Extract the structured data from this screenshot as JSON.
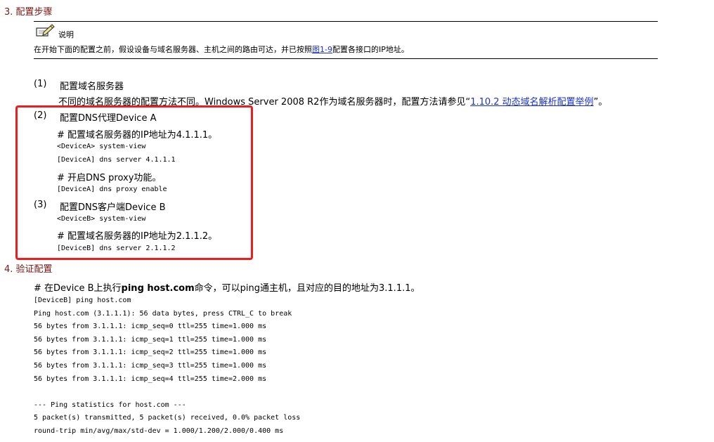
{
  "colors": {
    "heading": "#7a1712",
    "link": "#1a33cc",
    "highlight_box": "#ee1c1c"
  },
  "section3": {
    "heading": "3. 配置步骤",
    "note": {
      "label": "说明",
      "text_before": "在开始下面的配置之前，假设设备与域名服务器、主机之间的路由可达，并已按照",
      "link": "图1-9",
      "text_after": "配置各接口的IP地址。"
    },
    "step1": {
      "num": "(1)",
      "title": "配置域名服务器",
      "desc_before": "不同的域名服务器的配置方法不同。Windows Server 2008 R2作为域名服务器时，配置方法请参见“",
      "desc_link": "1.10.2  动态域名解析配置举例",
      "desc_after": "”。"
    },
    "step2": {
      "num": "(2)",
      "title": "配置DNS代理Device A",
      "comment1": "# 配置域名服务器的IP地址为4.1.1.1。",
      "cmd1": "<DeviceA> system-view",
      "cmd2": "[DeviceA] dns server 4.1.1.1",
      "comment2": "# 开启DNS proxy功能。",
      "cmd3": "[DeviceA] dns proxy enable"
    },
    "step3": {
      "num": "(3)",
      "title": "配置DNS客户端Device B",
      "cmd1": "<DeviceB> system-view",
      "comment1": "# 配置域名服务器的IP地址为2.1.1.2。",
      "cmd2": "[DeviceB] dns server 2.1.1.2"
    }
  },
  "section4": {
    "heading": "4. 验证配置",
    "intro_before": "# 在Device B上执行",
    "intro_bold": "ping host.com",
    "intro_after": "命令，可以ping通主机，且对应的目的地址为3.1.1.1。",
    "output": [
      "[DeviceB] ping host.com",
      "Ping host.com (3.1.1.1): 56 data bytes, press CTRL_C to break",
      "56 bytes from 3.1.1.1: icmp_seq=0 ttl=255 time=1.000 ms",
      "56 bytes from 3.1.1.1: icmp_seq=1 ttl=255 time=1.000 ms",
      "56 bytes from 3.1.1.1: icmp_seq=2 ttl=255 time=1.000 ms",
      "56 bytes from 3.1.1.1: icmp_seq=3 ttl=255 time=1.000 ms",
      "56 bytes from 3.1.1.1: icmp_seq=4 ttl=255 time=2.000 ms",
      "",
      "--- Ping statistics for host.com ---",
      "5 packet(s) transmitted, 5 packet(s) received, 0.0% packet loss",
      "round-trip min/avg/max/std-dev = 1.000/1.200/2.000/0.400 ms"
    ]
  }
}
